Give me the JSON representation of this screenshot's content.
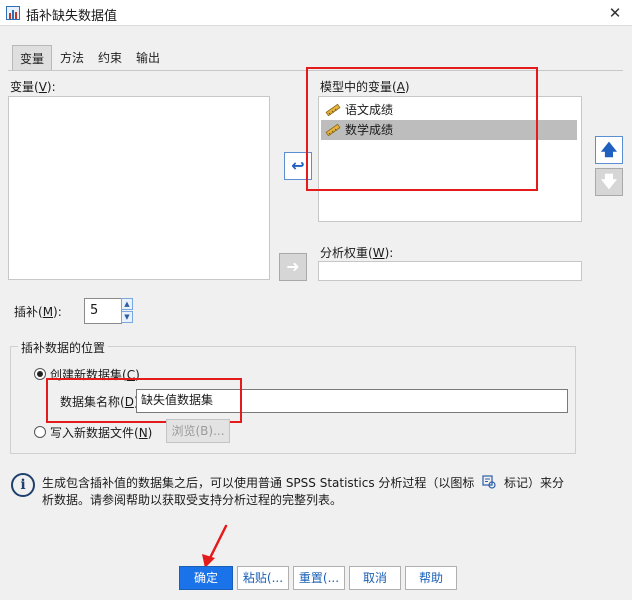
{
  "window": {
    "title": "插补缺失数据值",
    "close_glyph": "✕"
  },
  "tabs": [
    {
      "label": "变量",
      "active": true
    },
    {
      "label": "方法",
      "active": false
    },
    {
      "label": "约束",
      "active": false
    },
    {
      "label": "输出",
      "active": false
    }
  ],
  "variables": {
    "label": "变量(",
    "mnemonic": "V",
    "label_end": "):",
    "items": []
  },
  "model_vars": {
    "label": "模型中的变量(",
    "mnemonic": "A",
    "label_end": ")",
    "items": [
      {
        "label": "语文成绩",
        "selected": false,
        "icon": "scale-ruler-icon"
      },
      {
        "label": "数学成绩",
        "selected": true,
        "icon": "scale-ruler-icon"
      }
    ]
  },
  "move_left_glyph": "↩",
  "move_right_glyph": "➜",
  "move_up_glyph": "🡅",
  "move_down_glyph": "🡇",
  "weight": {
    "label": "分析权重(",
    "mnemonic": "W",
    "label_end": "):",
    "value": ""
  },
  "imputations": {
    "label": "插补(",
    "mnemonic": "M",
    "label_end": "):",
    "value": "5"
  },
  "location": {
    "group_label": "插补数据的位置",
    "create_new": {
      "label": "创建新数据集(",
      "mnemonic": "C",
      "label_end": ")",
      "checked": true
    },
    "dataset_name": {
      "label": "数据集名称(",
      "mnemonic": "D",
      "label_end": "):",
      "value": "缺失值数据集"
    },
    "write_file": {
      "label": "写入新数据文件(",
      "mnemonic": "N",
      "label_end": ")",
      "checked": false
    },
    "browse": "浏览(B)..."
  },
  "info": {
    "line1_pre": "生成包含插补值的数据集之后，可以使用普通 SPSS Statistics 分析过程（以图标",
    "line1_post": "标记）来分",
    "line2": "析数据。请参阅帮助以获取受支持分析过程的完整列表。"
  },
  "buttons": {
    "ok": "确定",
    "paste": "粘贴(...",
    "reset": "重置(...",
    "cancel": "取消",
    "help": "帮助"
  },
  "colors": {
    "accent": "#1a73e8",
    "highlight": "#e31b1b"
  }
}
